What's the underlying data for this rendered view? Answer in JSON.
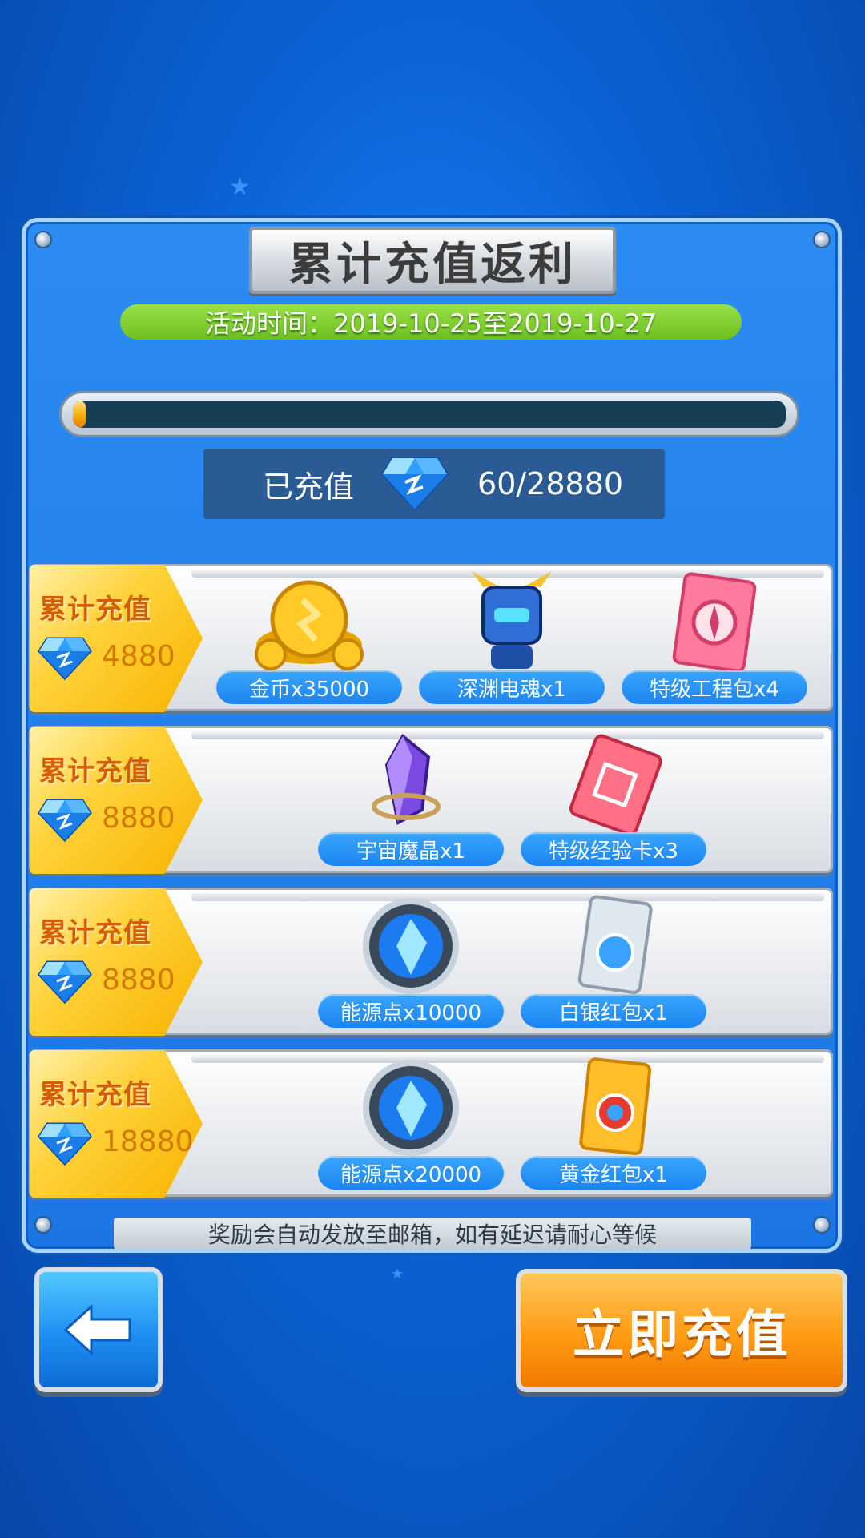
{
  "title": "累计充值返利",
  "event_time": "活动时间：2019-10-25至2019-10-27",
  "progress": {
    "label": "已充值",
    "current": 60,
    "target": 28880,
    "text": "60/28880",
    "fraction": 0.002
  },
  "tiers": [
    {
      "label": "累计充值",
      "value": "4880",
      "items": [
        {
          "name": "金币x35000",
          "icon": "gold-coins-icon"
        },
        {
          "name": "深渊电魂x1",
          "icon": "abyss-robot-icon"
        },
        {
          "name": "特级工程包x4",
          "icon": "engineering-pack-icon"
        }
      ]
    },
    {
      "label": "累计充值",
      "value": "8880",
      "items": [
        {
          "name": "宇宙魔晶x1",
          "icon": "cosmic-crystal-icon"
        },
        {
          "name": "特级经验卡x3",
          "icon": "exp-card-icon"
        }
      ]
    },
    {
      "label": "累计充值",
      "value": "8880",
      "items": [
        {
          "name": "能源点x10000",
          "icon": "energy-point-icon"
        },
        {
          "name": "白银红包x1",
          "icon": "silver-red-packet-icon"
        }
      ]
    },
    {
      "label": "累计充值",
      "value": "18880",
      "items": [
        {
          "name": "能源点x20000",
          "icon": "energy-point-icon"
        },
        {
          "name": "黄金红包x1",
          "icon": "gold-red-packet-icon"
        }
      ]
    }
  ],
  "footer_note": "奖励会自动发放至邮箱，如有延迟请耐心等候",
  "buttons": {
    "back_icon": "back-arrow-icon",
    "recharge_label": "立即充值"
  },
  "colors": {
    "background": "#0b63d6",
    "time_bar": "#6cc01e",
    "tier_gold": "#ffd23a",
    "item_label": "#1b84f0",
    "recharge_orange": "#ff9b14"
  }
}
